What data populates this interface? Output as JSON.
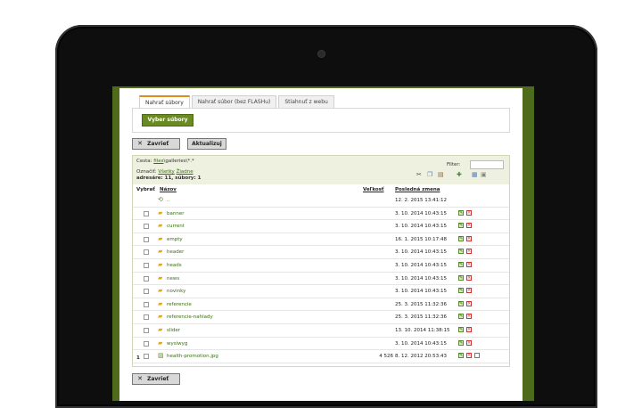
{
  "tabs": [
    {
      "label": "Nahrať súbory",
      "active": true
    },
    {
      "label": "Nahrať súbor (bez FLASHu)",
      "active": false
    },
    {
      "label": "Stiahnuť z webu",
      "active": false
    }
  ],
  "upload": {
    "choose_label": "Vyber súbory"
  },
  "toolbar": {
    "close_label": "Zavrieť",
    "refresh_label": "Aktualizuj"
  },
  "browser": {
    "path_label": "Cesta:",
    "path_link": "files",
    "path_rest": "\\galleries\\*.*",
    "filter_label": "Filter:",
    "mark_label": "Označiť:",
    "mark_all": "Všetky",
    "mark_none": "Žiadne",
    "summary": "adresáre: 11, súbory: 1",
    "columns": {
      "select": "Vybrať",
      "name": "Názov",
      "size": "Veľkosť",
      "modified": "Posledná zmena"
    },
    "count": "1"
  },
  "rows": [
    {
      "icon": "up-folder-icon",
      "name": "..",
      "size": "",
      "date": "12. 2. 2015 13:41:12",
      "actions": 0
    },
    {
      "icon": "folder-icon",
      "name": "banner",
      "size": "",
      "date": "3. 10. 2014 10:43:15",
      "actions": 2
    },
    {
      "icon": "folder-icon",
      "name": "current",
      "size": "",
      "date": "3. 10. 2014 10:43:15",
      "actions": 2
    },
    {
      "icon": "folder-icon",
      "name": "empty",
      "size": "",
      "date": "16. 1. 2015 10:17:48",
      "actions": 2
    },
    {
      "icon": "folder-icon",
      "name": "header",
      "size": "",
      "date": "3. 10. 2014 10:43:15",
      "actions": 2
    },
    {
      "icon": "folder-icon",
      "name": "heads",
      "size": "",
      "date": "3. 10. 2014 10:43:15",
      "actions": 2
    },
    {
      "icon": "folder-icon",
      "name": "news",
      "size": "",
      "date": "3. 10. 2014 10:43:15",
      "actions": 2
    },
    {
      "icon": "folder-icon",
      "name": "novinky",
      "size": "",
      "date": "3. 10. 2014 10:43:15",
      "actions": 2
    },
    {
      "icon": "folder-icon",
      "name": "referencie",
      "size": "",
      "date": "25. 3. 2015 11:32:36",
      "actions": 2
    },
    {
      "icon": "folder-icon",
      "name": "referencie-nahlady",
      "size": "",
      "date": "25. 3. 2015 11:32:36",
      "actions": 2
    },
    {
      "icon": "folder-icon",
      "name": "slider",
      "size": "",
      "date": "13. 10. 2014 11:38:15",
      "actions": 2
    },
    {
      "icon": "folder-icon",
      "name": "wysiwyg",
      "size": "",
      "date": "3. 10. 2014 10:43:15",
      "actions": 2
    },
    {
      "icon": "image-file-icon",
      "name": "health-promotion.jpg",
      "size": "4 526",
      "date": "8. 12. 2012 20:53:43",
      "actions": 3
    }
  ],
  "colors": {
    "accent": "#6a8a22",
    "frame": "#4e6b1b",
    "tab_active": "#e08a1c",
    "link": "#3a6d12"
  }
}
